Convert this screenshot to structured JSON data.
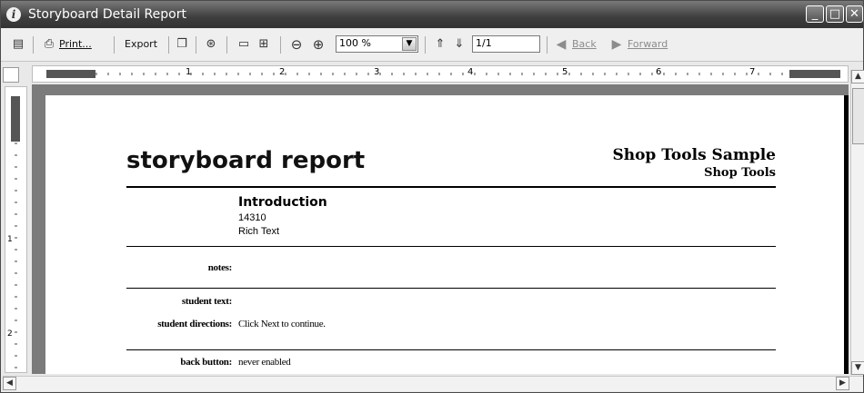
{
  "window": {
    "title": "Storyboard Detail Report",
    "app_icon": "app-logo-icon",
    "controls": [
      "minimize",
      "maximize",
      "close"
    ]
  },
  "toolbar": {
    "print_label": "Print...",
    "export_label": "Export",
    "zoom_value": "100 %",
    "page_value": "1/1",
    "back_label": "Back",
    "forward_label": "Forward"
  },
  "ruler": {
    "h_numbers": [
      "1",
      "2",
      "3",
      "4",
      "5",
      "6",
      "7"
    ],
    "v_numbers": [
      "1",
      "2"
    ]
  },
  "report": {
    "title": "storyboard report",
    "project": "Shop Tools Sample",
    "subproject": "Shop Tools",
    "section": {
      "name": "Introduction",
      "id": "14310",
      "type": "Rich Text"
    },
    "fields": [
      {
        "label": "notes:",
        "value": ""
      },
      {
        "label": "student text:",
        "value": ""
      },
      {
        "label": "student directions:",
        "value": "Click Next to continue."
      },
      {
        "label": "back button:",
        "value": "never enabled"
      }
    ]
  }
}
